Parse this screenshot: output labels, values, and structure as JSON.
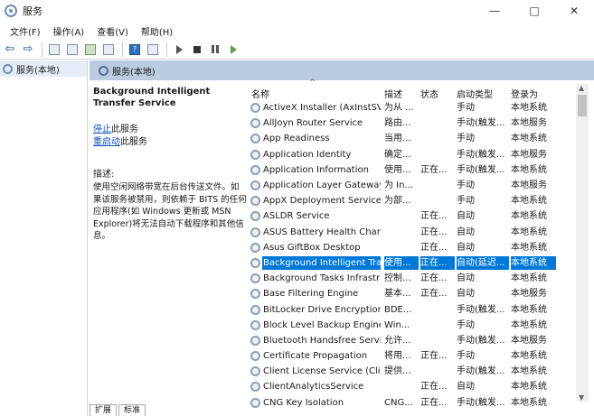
{
  "window": {
    "title": "服务",
    "minimize_glyph": "—",
    "maximize_glyph": "□",
    "close_glyph": "✕"
  },
  "menu": [
    "文件(F)",
    "操作(A)",
    "查看(V)",
    "帮助(H)"
  ],
  "tree": {
    "root_label": "服务(本地)"
  },
  "panel": {
    "header": "服务(本地)"
  },
  "description": {
    "service_title": "Background Intelligent Transfer Service",
    "stop_link": "停止",
    "stop_suffix": "此服务",
    "restart_link": "重启动",
    "restart_suffix": "此服务",
    "label": "描述:",
    "text": "使用空闲网络带宽在后台传送文件。如果该服务被禁用，则依赖于 BITS 的任何应用程序(如 Windows 更新或 MSN Explorer)将无法自动下载程序和其他信息。"
  },
  "table": {
    "headers": [
      "名称",
      "描述",
      "状态",
      "启动类型",
      "登录为"
    ],
    "rows": [
      {
        "name": "ActiveX Installer (AxInstSV)",
        "desc": "为从 ...",
        "status": "",
        "start": "手动",
        "logon": "本地系统"
      },
      {
        "name": "AllJoyn Router Service",
        "desc": "路由...",
        "status": "",
        "start": "手动(触发...",
        "logon": "本地服务"
      },
      {
        "name": "App Readiness",
        "desc": "当用...",
        "status": "",
        "start": "手动",
        "logon": "本地系统"
      },
      {
        "name": "Application Identity",
        "desc": "确定...",
        "status": "",
        "start": "手动(触发...",
        "logon": "本地服务"
      },
      {
        "name": "Application Information",
        "desc": "使用...",
        "status": "正在...",
        "start": "手动(触发...",
        "logon": "本地系统"
      },
      {
        "name": "Application Layer Gateway ...",
        "desc": "为 In...",
        "status": "",
        "start": "手动",
        "logon": "本地服务"
      },
      {
        "name": "AppX Deployment Service ...",
        "desc": "为部...",
        "status": "",
        "start": "手动",
        "logon": "本地系统"
      },
      {
        "name": "ASLDR Service",
        "desc": "",
        "status": "正在...",
        "start": "自动",
        "logon": "本地系统"
      },
      {
        "name": "ASUS Battery Health Charg...",
        "desc": "",
        "status": "正在...",
        "start": "自动",
        "logon": "本地系统"
      },
      {
        "name": "Asus GiftBox Desktop",
        "desc": "",
        "status": "正在...",
        "start": "自动",
        "logon": "本地系统"
      },
      {
        "name": "Background Intelligent Tra...",
        "desc": "使用...",
        "status": "正在...",
        "start": "自动(延迟...",
        "logon": "本地系统",
        "selected": true
      },
      {
        "name": "Background Tasks Infrastru...",
        "desc": "控制...",
        "status": "正在...",
        "start": "自动",
        "logon": "本地系统"
      },
      {
        "name": "Base Filtering Engine",
        "desc": "基本...",
        "status": "正在...",
        "start": "自动",
        "logon": "本地服务"
      },
      {
        "name": "BitLocker Drive Encryption ...",
        "desc": "BDE...",
        "status": "",
        "start": "手动(触发...",
        "logon": "本地系统"
      },
      {
        "name": "Block Level Backup Engine ...",
        "desc": "Win...",
        "status": "",
        "start": "手动",
        "logon": "本地系统"
      },
      {
        "name": "Bluetooth Handsfree Service",
        "desc": "允许...",
        "status": "",
        "start": "手动(触发...",
        "logon": "本地服务"
      },
      {
        "name": "Certificate Propagation",
        "desc": "将用...",
        "status": "正在...",
        "start": "手动",
        "logon": "本地系统"
      },
      {
        "name": "Client License Service (Clip...",
        "desc": "提供...",
        "status": "",
        "start": "手动(触发...",
        "logon": "本地系统"
      },
      {
        "name": "ClientAnalyticsService",
        "desc": "",
        "status": "正在...",
        "start": "自动",
        "logon": "本地系统"
      },
      {
        "name": "CNG Key Isolation",
        "desc": "CNG...",
        "status": "正在...",
        "start": "手动(触发...",
        "logon": "本地系统"
      }
    ]
  },
  "tabs": [
    "扩展",
    "标准"
  ]
}
